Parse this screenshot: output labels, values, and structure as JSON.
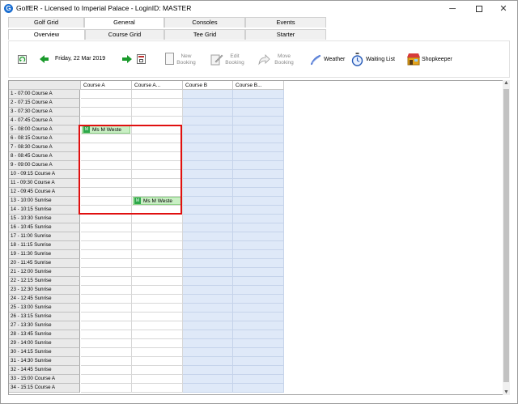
{
  "window": {
    "title": "GolfER - Licensed to Imperial Palace - LoginID: MASTER",
    "min_glyph": "─",
    "close_glyph": "✕"
  },
  "main_tabs": [
    {
      "label": "Golf Grid"
    },
    {
      "label": "General"
    },
    {
      "label": "Consoles"
    },
    {
      "label": "Events"
    }
  ],
  "sub_tabs": [
    {
      "label": "Overview"
    },
    {
      "label": "Course Grid"
    },
    {
      "label": "Tee Grid"
    },
    {
      "label": "Starter"
    }
  ],
  "toolbar": {
    "date": "Friday, 22 Mar 2019",
    "new_label_1": "New",
    "new_label_2": "Booking",
    "edit_label_1": "Edit",
    "edit_label_2": "Booking",
    "move_label_1": "Move",
    "move_label_2": "Booking",
    "weather_label": "Weather",
    "waiting_list_label": "Waiting List",
    "shopkeeper_label": "Shopkeeper"
  },
  "grid": {
    "columns": [
      "Course A",
      "Course A...",
      "Course B",
      "Course B..."
    ],
    "rows": [
      "1 - 07:00 Course A",
      "2 - 07:15 Course A",
      "3 - 07:30 Course A",
      "4 - 07:45 Course A",
      "5 - 08:00 Course A",
      "6 - 08:15 Course A",
      "7 - 08:30 Course A",
      "8 - 08:45 Course A",
      "9 - 09:00 Course A",
      "10 - 09:15 Course A",
      "11 - 09:30 Course A",
      "12 - 09:45 Course A",
      "13 - 10:00 Sunrise",
      "14 - 10:15 Sunrise",
      "15 - 10:30 Sunrise",
      "16 - 10:45 Sunrise",
      "17 - 11:00 Sunrise",
      "18 - 11:15 Sunrise",
      "19 - 11:30 Sunrise",
      "20 - 11:45 Sunrise",
      "21 - 12:00 Sunrise",
      "22 - 12:15 Sunrise",
      "23 - 12:30 Sunrise",
      "24 - 12:45 Sunrise",
      "25 - 13:00 Sunrise",
      "26 - 13:15 Sunrise",
      "27 - 13:30 Sunrise",
      "28 - 13:45 Sunrise",
      "29 - 14:00 Sunrise",
      "30 - 14:15 Sunrise",
      "31 - 14:30 Sunrise",
      "32 - 14:45 Sunrise",
      "33 - 15:00 Course A",
      "34 - 15:15 Course A"
    ],
    "bookings": [
      {
        "name": "Ms M Weste",
        "row": 4,
        "col": 0
      },
      {
        "name": "Ms M Weste",
        "row": 12,
        "col": 1
      }
    ]
  },
  "colors": {
    "accent_green": "#1a9a2c",
    "booking_fill": "#c9efc4",
    "course_b_fill": "#dfe9f8",
    "highlight": "#e01010"
  }
}
